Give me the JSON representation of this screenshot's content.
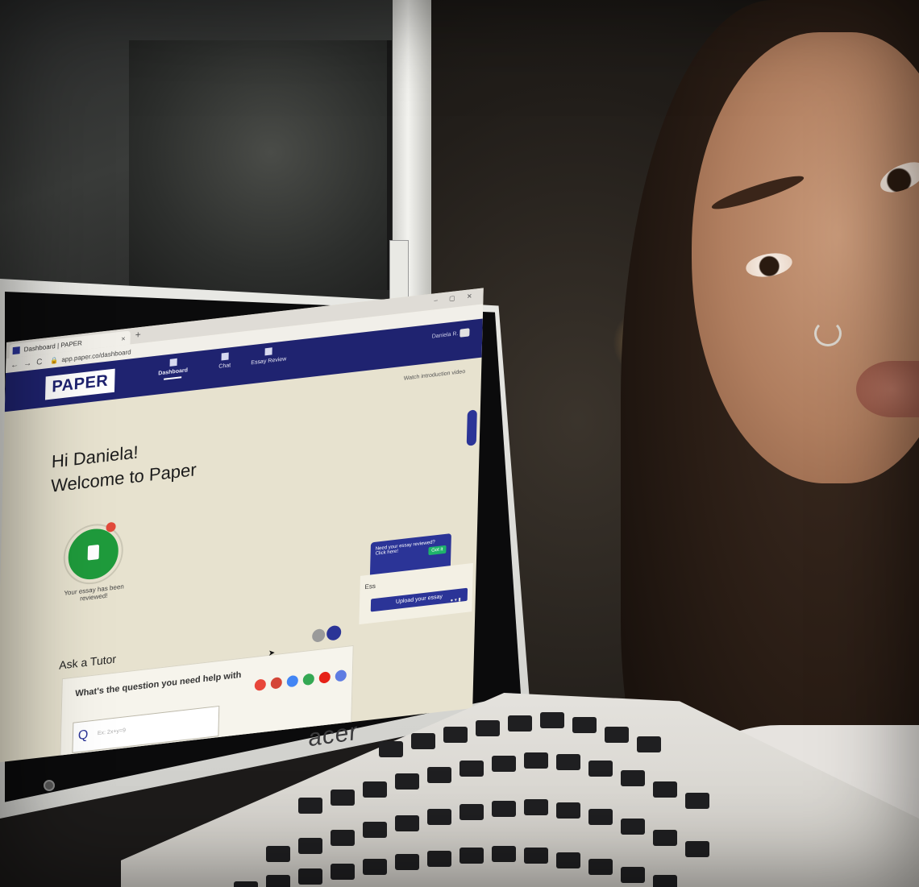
{
  "browser": {
    "tab_title": "Dashboard | PAPER",
    "tab_close": "×",
    "new_tab": "+",
    "url": "app.paper.co/dashboard"
  },
  "app": {
    "logo": "PAPER",
    "nav": [
      {
        "label": "Dashboard"
      },
      {
        "label": "Chat"
      },
      {
        "label": "Essay Review"
      }
    ],
    "user_name": "Daniela R."
  },
  "main": {
    "intro_link": "Watch introduction video",
    "greeting_line1": "Hi Daniela!",
    "greeting_line2": "Welcome to Paper",
    "review_status": "Your essay has been reviewed!",
    "tooltip_text": "Need your essay reviewed? Click here!",
    "tooltip_button": "Got it",
    "essay_label": "Ess",
    "upload_button": "Upload your essay",
    "ask_title": "Ask a Tutor",
    "question_title": "What's the question you need help with",
    "question_icon_letter": "Q",
    "question_placeholder": "Ex: 2x+y=9"
  },
  "laptop_brand": "acer",
  "colors": {
    "brand_navy": "#1f2370",
    "accent_blue": "#2b3497",
    "success_green": "#1f9b3c",
    "alert_red": "#e24a3b",
    "screen_bg": "#e7e2cf"
  }
}
